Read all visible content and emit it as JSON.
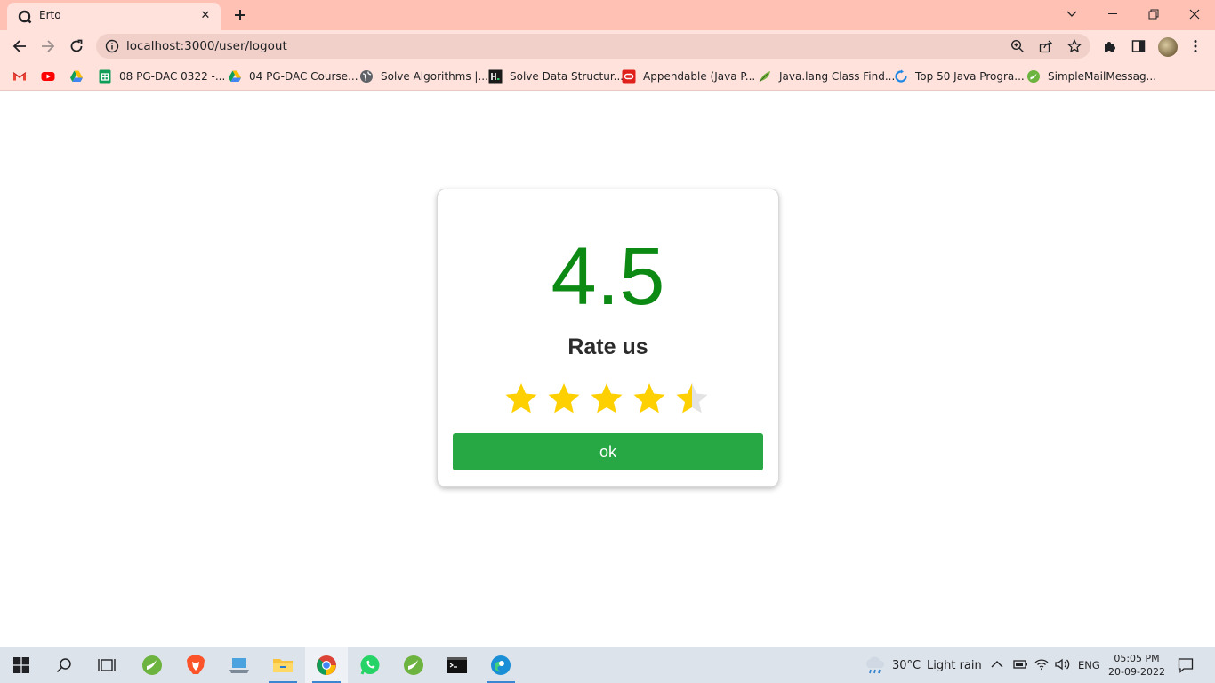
{
  "browser": {
    "tab_title": "Erto",
    "url": "localhost:3000/user/logout",
    "bookmarks": [
      {
        "label": "08 PG-DAC 0322 -...",
        "icon": "google-sheets-icon"
      },
      {
        "label": "04 PG-DAC Course...",
        "icon": "google-drive-icon"
      },
      {
        "label": "Solve Algorithms |...",
        "icon": "globe-icon"
      },
      {
        "label": "Solve Data Structur...",
        "icon": "hackerrank-icon"
      },
      {
        "label": "Appendable (Java P...",
        "icon": "oracle-icon"
      },
      {
        "label": "Java.lang Class Find...",
        "icon": "leaf-icon"
      },
      {
        "label": "Top 50 Java Progra...",
        "icon": "refresh-logo-icon"
      },
      {
        "label": "SimpleMailMessag...",
        "icon": "spring-icon"
      }
    ]
  },
  "rating": {
    "value": "4.5",
    "title": "Rate us",
    "stars_filled": 4.5,
    "stars_total": 5,
    "button_label": "ok",
    "value_color": "#0d8a13",
    "button_color": "#28a745",
    "star_color": "#ffd000"
  },
  "taskbar": {
    "weather_temp": "30°C",
    "weather_desc": "Light rain",
    "language": "ENG",
    "time": "05:05 PM",
    "date": "20-09-2022"
  }
}
